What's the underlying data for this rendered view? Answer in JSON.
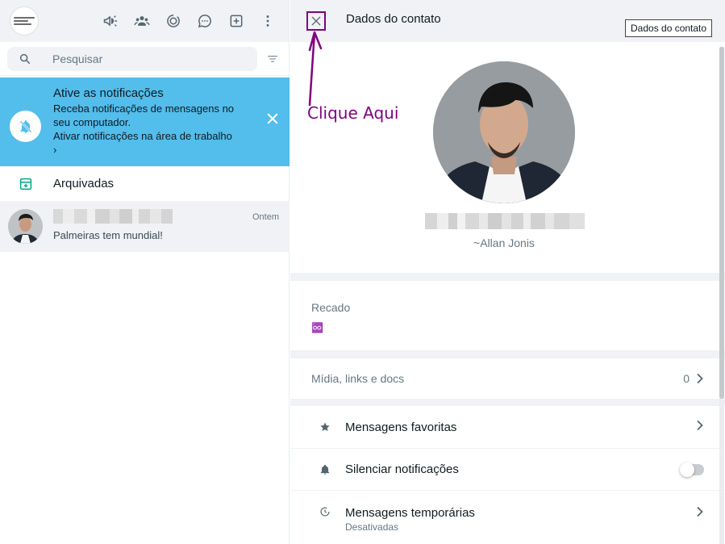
{
  "left": {
    "search": {
      "placeholder": "Pesquisar"
    },
    "notification": {
      "title": "Ative as notificações",
      "subtitle": "Receba notificações de mensagens no seu computador.",
      "link": "Ativar notificações na área de trabalho",
      "chevron": "›"
    },
    "archived": {
      "label": "Arquivadas"
    },
    "chats": [
      {
        "last_message": "Palmeiras tem mundial!",
        "time": "Ontem"
      }
    ]
  },
  "right": {
    "header": {
      "title": "Dados do contato"
    },
    "tooltip": "Dados do contato",
    "profile": {
      "alias": "~Allan Jonis"
    },
    "recado": {
      "label": "Recado",
      "value": "♾️"
    },
    "media": {
      "label": "Mídia, links e docs",
      "count": "0"
    },
    "options": [
      {
        "label": "Mensagens favoritas",
        "icon": "star-icon"
      },
      {
        "label": "Silenciar notificações",
        "icon": "bell-icon"
      },
      {
        "label": "Mensagens temporárias",
        "sub": "Desativadas",
        "icon": "timer-icon"
      }
    ]
  },
  "annotation": {
    "text": "Clique Aqui",
    "color": "#800080"
  },
  "colors": {
    "notification_bg": "#53bdeb",
    "accent_green": "#00a884",
    "panel_bg": "#f0f2f5"
  }
}
